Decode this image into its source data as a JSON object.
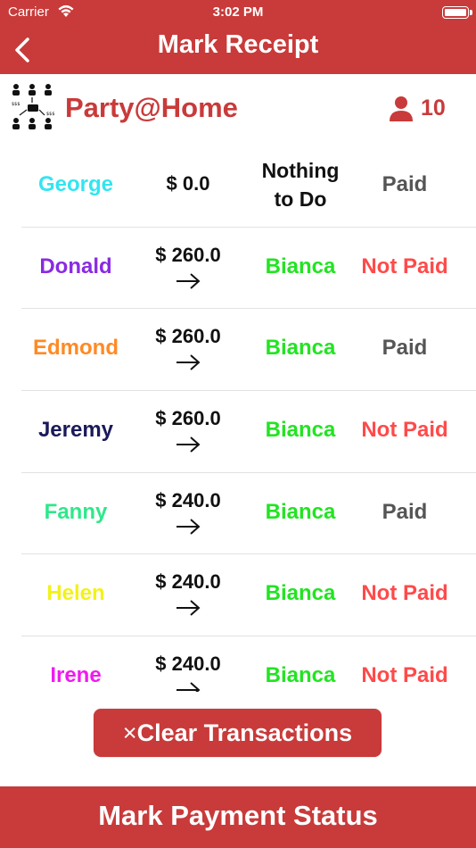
{
  "status_bar": {
    "carrier": "Carrier",
    "time": "3:02 PM"
  },
  "nav": {
    "title": "Mark Receipt"
  },
  "group": {
    "name": "Party@Home",
    "member_count": "10"
  },
  "colors": {
    "primary": "#c93a3a",
    "payee": "#22e422",
    "paid": "#555555",
    "not_paid": "#ff4a4a"
  },
  "rows": [
    {
      "name": "George",
      "name_color": "#33e5f0",
      "amount": "$ 0.0",
      "to_line1": "Nothing",
      "to_line2": "to Do",
      "status": "Paid",
      "status_color": "#555555"
    },
    {
      "name": "Donald",
      "name_color": "#8a2be2",
      "amount": "$ 260.0",
      "to": "Bianca",
      "status": "Not Paid",
      "status_color": "#ff4a4a"
    },
    {
      "name": "Edmond",
      "name_color": "#ff8a24",
      "amount": "$ 260.0",
      "to": "Bianca",
      "status": "Paid",
      "status_color": "#555555"
    },
    {
      "name": "Jeremy",
      "name_color": "#1a1a5a",
      "amount": "$ 260.0",
      "to": "Bianca",
      "status": "Not Paid",
      "status_color": "#ff4a4a"
    },
    {
      "name": "Fanny",
      "name_color": "#2ee88a",
      "amount": "$ 240.0",
      "to": "Bianca",
      "status": "Paid",
      "status_color": "#555555"
    },
    {
      "name": "Helen",
      "name_color": "#f2f21a",
      "amount": "$ 240.0",
      "to": "Bianca",
      "status": "Not Paid",
      "status_color": "#ff4a4a"
    },
    {
      "name": "Irene",
      "name_color": "#f01af0",
      "amount": "$ 240.0",
      "to": "Bianca",
      "status": "Not Paid",
      "status_color": "#ff4a4a"
    }
  ],
  "clear_button": {
    "icon": "×",
    "label": "Clear Transactions"
  },
  "bottom_bar": {
    "label": "Mark Payment Status"
  }
}
